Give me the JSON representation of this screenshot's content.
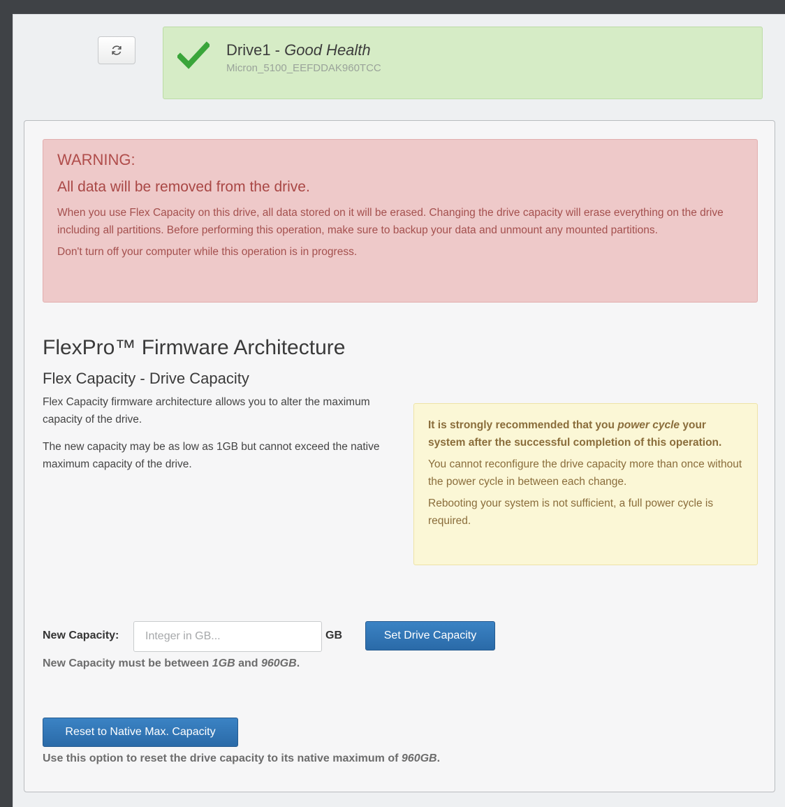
{
  "drive": {
    "name": "Drive1 - ",
    "health": "Good Health",
    "model": "Micron_5100_EEFDDAK960TCC"
  },
  "warning": {
    "title": "WARNING:",
    "subtitle": "All data will be removed from the drive.",
    "text1": "When you use Flex Capacity on this drive, all data stored on it will be erased. Changing the drive capacity will erase everything on the drive including all partitions. Before performing this operation, make sure to backup your data and unmount any mounted partitions.",
    "text2": "Don't turn off your computer while this operation is in progress."
  },
  "flex": {
    "title": "FlexPro™ Firmware Architecture",
    "subtitle": "Flex Capacity - Drive Capacity",
    "desc1": "Flex Capacity firmware architecture allows you to alter the maximum capacity of the drive.",
    "desc2": "The new capacity may be as low as 1GB but cannot exceed the native maximum capacity of the drive."
  },
  "note": {
    "strong_prefix": "It is strongly recommended that you ",
    "strong_italic": "power cycle",
    "strong_suffix": " your system after the successful completion of this operation.",
    "line2": "You cannot reconfigure the drive capacity more than once without the power cycle in between each change.",
    "line3": "Rebooting your system is not sufficient, a full power cycle is required."
  },
  "capacity": {
    "label": "New Capacity:",
    "placeholder": "Integer in GB...",
    "value": "",
    "unit": "GB",
    "set_button": "Set Drive Capacity",
    "hint_prefix": "New Capacity must be between ",
    "hint_min": "1GB",
    "hint_mid": " and ",
    "hint_max": "960GB",
    "hint_suffix": "."
  },
  "reset": {
    "button": "Reset to Native Max. Capacity",
    "hint_prefix": "Use this option to reset the drive capacity to its native maximum of ",
    "hint_value": "960GB",
    "hint_suffix": "."
  },
  "colors": {
    "success_bg": "#d6ecc6",
    "warning_bg": "#eec9c9",
    "note_bg": "#fbf7d6",
    "primary": "#2f74b5",
    "check": "#3aa53a"
  },
  "icons": {
    "refresh": "refresh-icon",
    "status": "checkmark-icon"
  }
}
